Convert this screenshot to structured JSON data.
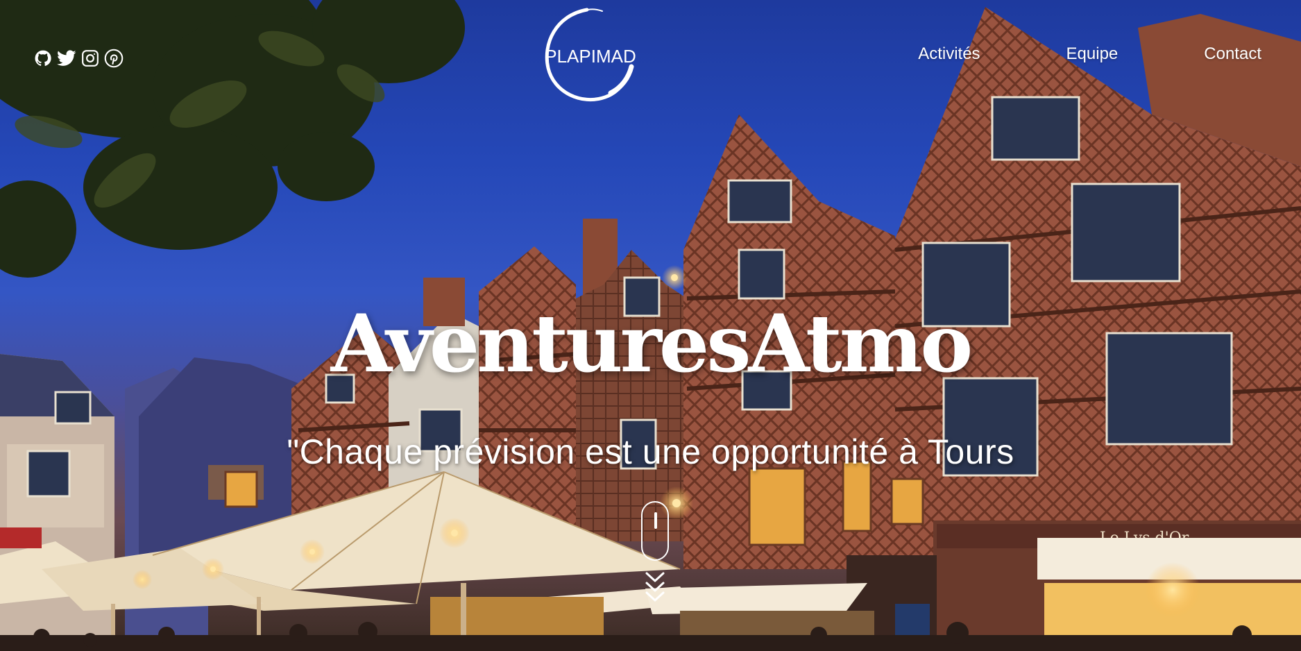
{
  "social": {
    "github": "github-icon",
    "twitter": "twitter-icon",
    "instagram": "instagram-icon",
    "pinterest": "pinterest-icon"
  },
  "logo": {
    "text": "PLAPIMAD"
  },
  "nav": {
    "items": [
      {
        "label": "Activités"
      },
      {
        "label": "Equipe"
      },
      {
        "label": "Contact"
      }
    ]
  },
  "hero": {
    "title": "AventuresAtmo",
    "subtitle": "\"Chaque prévision est une opportunité à Tours"
  },
  "colors": {
    "sky": "#2548b8",
    "text": "#ffffff",
    "timber": "#8a4a35",
    "lamp": "#ffd27a"
  }
}
